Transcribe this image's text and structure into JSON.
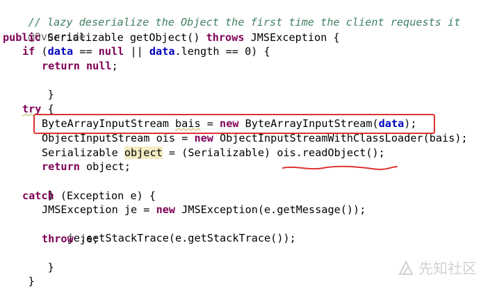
{
  "code": {
    "l1": "// lazy deserialize the Object the first time the client requests it",
    "l2_annotation": "@Override",
    "l3": {
      "kw_public": "public",
      "t1": " Serializable getObject() ",
      "kw_throws": "throws",
      "t2": " JMSException {"
    },
    "l4": {
      "kw_if": "if",
      "t1": " (",
      "f1": "data",
      "t2": " == ",
      "kw_null": "null",
      "t3": " || ",
      "f2": "data",
      "t4": ".length == ",
      "num": "0",
      "t5": ") {"
    },
    "l5": {
      "kw_return": "return",
      "sp": " ",
      "kw_null": "null",
      "t1": ";"
    },
    "l6": "}",
    "l8": {
      "kw_try": "try",
      "t1": " {"
    },
    "l9": {
      "t1": "ByteArrayInputStream ",
      "var": "bais",
      "t2": " = ",
      "kw_new": "new",
      "t3": " ByteArrayInputStream(",
      "f": "data",
      "t4": ");"
    },
    "l10": {
      "t1": "ObjectInputStream ois = ",
      "kw_new": "new",
      "t2": " ObjectInputStreamWithClassLoader(bais);"
    },
    "l11": {
      "t1": "Serializable ",
      "var": "object",
      "t2": " = (Serializable) ois.readObject();"
    },
    "l12": {
      "kw_return": "return",
      "t1": " object;"
    },
    "l13": "}",
    "l14": {
      "kw_catch": "catch",
      "t1": " (Exception e) {"
    },
    "l15": {
      "t1": "JMSException je = ",
      "kw_new": "new",
      "t2": " JMSException(e.getMessage());"
    },
    "l16": "je.setStackTrace(e.getStackTrace());",
    "l17": {
      "kw_throw": "throw",
      "t1": " je;"
    },
    "l18": "}",
    "l19": "}"
  },
  "watermark": {
    "text": "先知社区"
  },
  "colors": {
    "keyword": "#7f0055",
    "comment": "#3f7f5f",
    "annotation": "#646464",
    "field": "#0000c0",
    "highlight": "#f4ecc2",
    "box": "#e03030"
  }
}
